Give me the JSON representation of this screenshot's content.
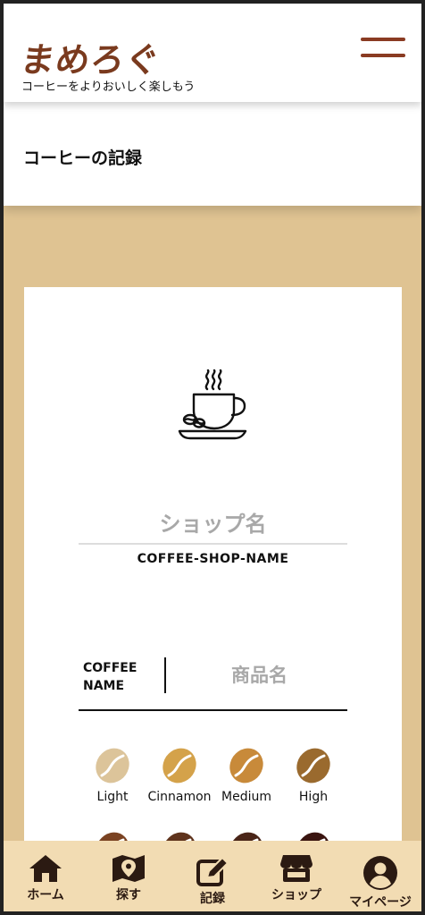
{
  "header": {
    "logo": "まめろぐ",
    "tagline": "コーヒーをよりおいしく楽しもう",
    "menu_icon": "hamburger-menu-icon"
  },
  "page": {
    "title": "コーヒーの記録"
  },
  "form": {
    "cup_icon": "coffee-cup-icon",
    "shop_name_placeholder": "ショップ名",
    "shop_name_label": "COFFEE-SHOP-NAME",
    "coffee_name_label_line1": "COFFEE",
    "coffee_name_label_line2": "NAME",
    "product_name_placeholder": "商品名",
    "roast_levels": [
      {
        "label": "Light",
        "color": "#dcc49a"
      },
      {
        "label": "Cinnamon",
        "color": "#d4a24a"
      },
      {
        "label": "Medium",
        "color": "#c88a3a"
      },
      {
        "label": "High",
        "color": "#9a6a2e"
      }
    ],
    "roast_levels_row2_colors": [
      "#7a4222",
      "#5f331c",
      "#4a2518",
      "#3a1510"
    ]
  },
  "bottom_nav": {
    "items": [
      {
        "label": "ホーム",
        "icon": "home-icon"
      },
      {
        "label": "探す",
        "icon": "map-pin-icon"
      },
      {
        "label": "記録",
        "icon": "edit-icon"
      },
      {
        "label": "ショップ",
        "icon": "store-icon"
      },
      {
        "label": "マイページ",
        "icon": "user-icon"
      }
    ]
  },
  "colors": {
    "brand": "#7a3a1e",
    "menu": "#8a3b22",
    "background": "#dfc392",
    "nav_background": "#f2dcb3"
  }
}
